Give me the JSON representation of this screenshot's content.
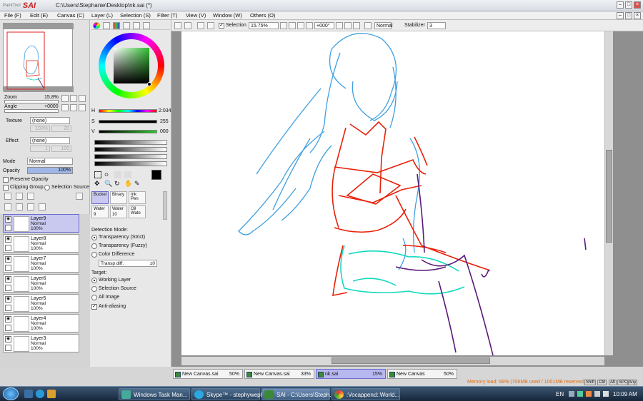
{
  "app": {
    "logo_text": "PaintTool",
    "logo_sub": "SAI",
    "title": "C:\\Users\\Stephanie\\Desktop\\nk.sai (*)"
  },
  "menu": [
    "File (F)",
    "Edit (E)",
    "Canvas (C)",
    "Layer (L)",
    "Selection (S)",
    "Filter (T)",
    "View (V)",
    "Window (W)",
    "Others (O)"
  ],
  "navigator": {
    "zoom_label": "Zoom",
    "zoom_value": "15.8%",
    "angle_label": "Angle",
    "angle_value": "+0000"
  },
  "layer_props": {
    "texture_label": "Texture",
    "texture_value": "(none)",
    "texture_scale": "100%",
    "texture_strength": "20",
    "effect_label": "Effect",
    "effect_value": "(none)",
    "effect_width": "1",
    "effect_strength": "100",
    "mode_label": "Mode",
    "mode_value": "Normal",
    "opacity_label": "Opacity",
    "opacity_value": "100%",
    "preserve_opacity": "Preserve Opacity",
    "clipping_group": "Clipping Group",
    "selection_source": "Selection Source"
  },
  "layers": [
    {
      "name": "Layer9",
      "mode": "Normal",
      "opacity": "100%"
    },
    {
      "name": "Layer8",
      "mode": "Normal",
      "opacity": "100%"
    },
    {
      "name": "Layer7",
      "mode": "Normal",
      "opacity": "100%"
    },
    {
      "name": "Layer6",
      "mode": "Normal",
      "opacity": "100%"
    },
    {
      "name": "Layer5",
      "mode": "Normal",
      "opacity": "100%"
    },
    {
      "name": "Layer4",
      "mode": "Normal",
      "opacity": "100%"
    },
    {
      "name": "Layer3",
      "mode": "Normal",
      "opacity": "100%"
    }
  ],
  "color": {
    "h_label": "H",
    "h_value": "2:034",
    "s_label": "S",
    "s_value": "255",
    "v_label": "V",
    "v_value": "000",
    "fg": "#000000",
    "bg": "#ffffff"
  },
  "tools": [
    {
      "name": "Bucket",
      "value": ""
    },
    {
      "name": "Binary",
      "value": ""
    },
    {
      "name": "Ink Pen",
      "value": ""
    },
    {
      "name": "Water",
      "value": "9"
    },
    {
      "name": "Water",
      "value": "10"
    },
    {
      "name": "Oil Wate",
      "value": ""
    }
  ],
  "bucket": {
    "detection_title": "Detection Mode:",
    "opt_strict": "Transparency (Strict)",
    "opt_fuzzy": "Transparency (Fuzzy)",
    "opt_color": "Color Difference",
    "transp_label": "Transp diff.",
    "transp_value": "±0",
    "target_title": "Target:",
    "tgt_working": "Working Layer",
    "tgt_selection": "Selection Source",
    "tgt_all": "All Image",
    "anti_alias": "Anti-aliasing"
  },
  "toolbar": {
    "selection_label": "Selection",
    "zoom_value": "15.75%",
    "angle_value": "+000°",
    "mode_value": "Normal",
    "stabilizer_label": "Stabilizer",
    "stabilizer_value": "3"
  },
  "tabs": [
    {
      "name": "New Canvas.sai",
      "zoom": "50%"
    },
    {
      "name": "New Canvas.sai",
      "zoom": "33%"
    },
    {
      "name": "nk.sai",
      "zoom": "15%"
    },
    {
      "name": "New Canvas",
      "zoom": "50%"
    }
  ],
  "status": {
    "memory": "Memory load: 88% (706MB used / 1001MB reserved)",
    "keys": [
      "Shift",
      "Ctrl",
      "Alt",
      "SPC",
      "Any"
    ]
  },
  "taskbar": {
    "items": [
      "Windows Task Man...",
      "Skype™ - stephyweph",
      "SAI - C:\\Users\\Steph...",
      ":Vocappend::World..."
    ],
    "lang": "EN",
    "clock": "10:09 AM"
  },
  "sketch_colors": {
    "blue": "#3fa0e0",
    "red": "#e8220a",
    "cyan": "#12d9c0",
    "purple": "#5a1a7a"
  }
}
